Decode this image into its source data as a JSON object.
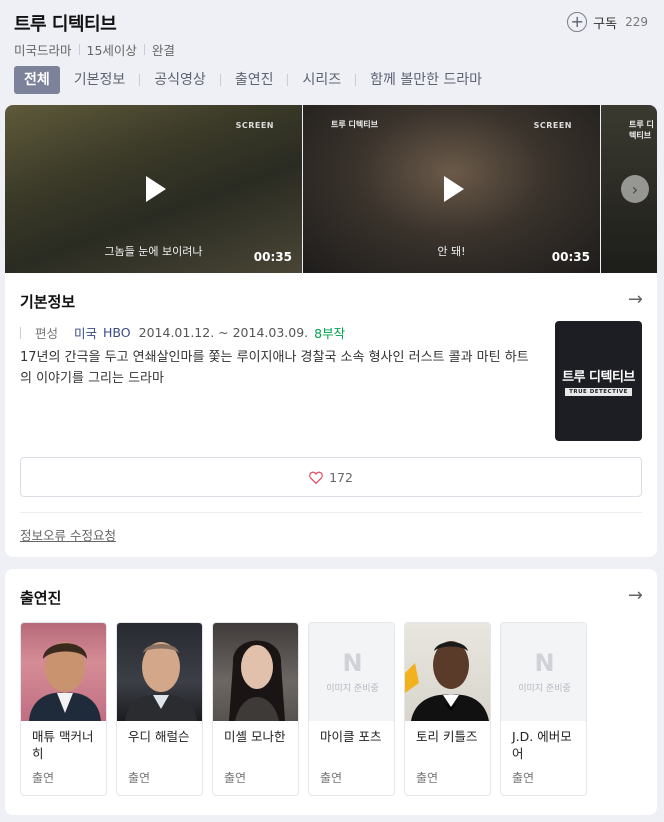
{
  "header": {
    "title": "트루 디텍티브",
    "subscribe_label": "구독",
    "subscribe_count": "229",
    "meta": [
      "미국드라마",
      "15세이상",
      "완결"
    ]
  },
  "tabs": [
    "전체",
    "기본정보",
    "공식영상",
    "출연진",
    "시리즈",
    "함께 볼만한 드라마"
  ],
  "videos": [
    {
      "subtitle": "그놈들 눈에 보이려나",
      "duration": "00:35",
      "tag": "SCREEN",
      "logo": ""
    },
    {
      "subtitle": "안 돼!",
      "duration": "00:35",
      "tag": "SCREEN",
      "logo": "트루 디텍티브"
    },
    {
      "logo": "트루 디텍티브"
    }
  ],
  "basic_info": {
    "title": "기본정보",
    "label": "편성",
    "country": "미국",
    "channel": "HBO",
    "dates": "2014.01.12. ~ 2014.03.09.",
    "episodes": "8부작",
    "description": "17년의 간극을 두고 연쇄살인마를 쫓는 루이지애나 경찰국 소속 형사인 러스트 콜과 마틴 하트의 이야기를 그리는 드라마",
    "poster_title": "트루 디텍티브",
    "poster_sub": "TRUE DETECTIVE",
    "likes": "172",
    "report_link": "정보오류 수정요청"
  },
  "cast": {
    "title": "출연진",
    "empty_image_text": "이미지 준비중",
    "members": [
      {
        "name": "매튜 맥커너히",
        "role": "출연",
        "photo": "photo"
      },
      {
        "name": "우디 해럴슨",
        "role": "출연",
        "photo": "photo"
      },
      {
        "name": "미셸 모나한",
        "role": "출연",
        "photo": "photo"
      },
      {
        "name": "마이클 포츠",
        "role": "출연",
        "photo": "empty"
      },
      {
        "name": "토리 키틀즈",
        "role": "출연",
        "photo": "photo"
      },
      {
        "name": "J.D. 에버모어",
        "role": "출연",
        "photo": "empty"
      }
    ]
  },
  "colors": {
    "active_tab": "#7b8299",
    "episodes_green": "#00a24a",
    "link_blue": "#3b4a84",
    "heart": "#e0485b"
  }
}
